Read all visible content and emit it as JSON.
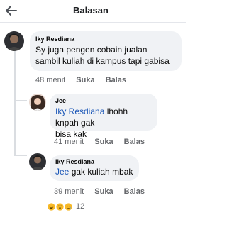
{
  "header": {
    "title": "Balasan"
  },
  "comments": [
    {
      "name": "Iky Resdiana",
      "text_lines": [
        "Sy juga pengen cobain jualan",
        "sambil kuliah di kampus tapi gabisa"
      ],
      "time": "48 menit",
      "like": "Suka",
      "reply": "Balas"
    },
    {
      "name": "Jee",
      "mention": "Iky Resdiana",
      "text_after_mention": " lhohh knpah gak",
      "text_line2": "bisa kak",
      "time": "41 menit",
      "like": "Suka",
      "reply": "Balas"
    },
    {
      "name": "Iky Resdiana",
      "mention": "Jee",
      "text_after_mention": " gak kuliah mbak",
      "time": "39 menit",
      "like": "Suka",
      "reply": "Balas"
    }
  ],
  "reactions": {
    "icons": [
      "haha-icon",
      "wow-icon",
      "sad-icon"
    ],
    "count": "12"
  }
}
